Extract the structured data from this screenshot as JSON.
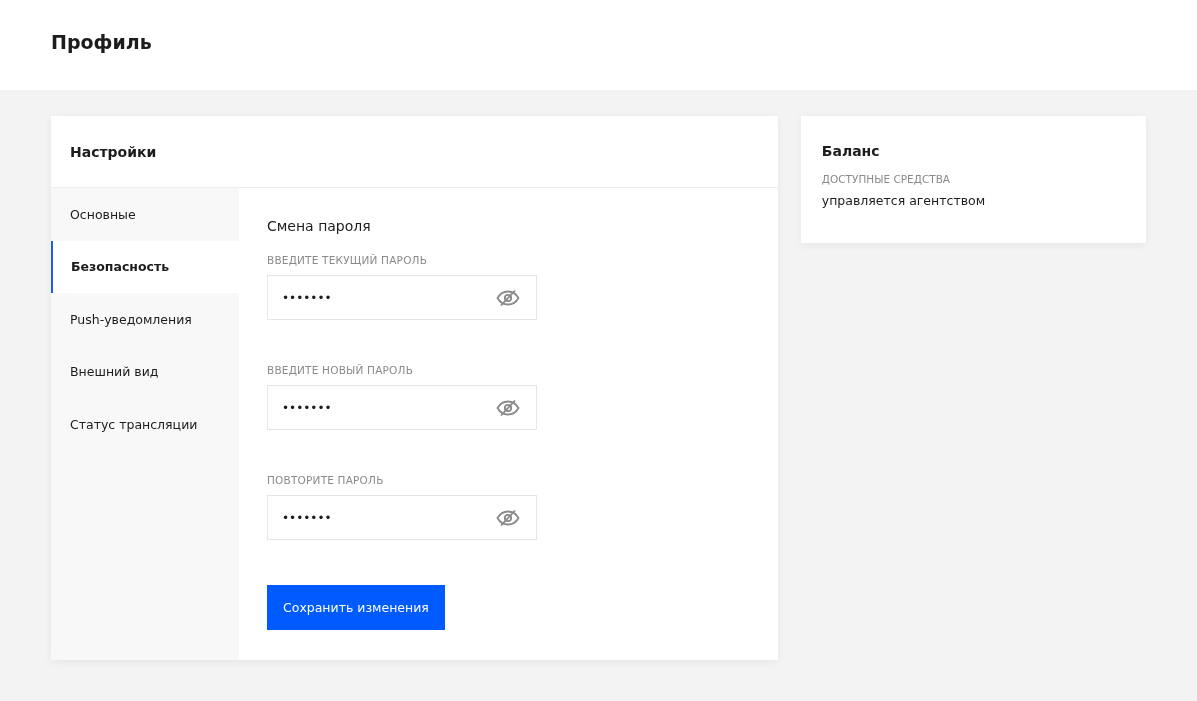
{
  "page": {
    "title": "Профиль"
  },
  "settings": {
    "title": "Настройки",
    "tabs": [
      {
        "label": "Основные",
        "selected": false
      },
      {
        "label": "Безопасность",
        "selected": true
      },
      {
        "label": "Push-уведомления",
        "selected": false
      },
      {
        "label": "Внешний вид",
        "selected": false
      },
      {
        "label": "Статус трансляции",
        "selected": false
      }
    ],
    "section_title": "Смена пароля",
    "fields": [
      {
        "label": "ВВЕДИТЕ ТЕКУЩИЙ ПАРОЛЬ",
        "value": "•••••••"
      },
      {
        "label": "ВВЕДИТЕ НОВЫЙ ПАРОЛЬ",
        "value": "•••••••"
      },
      {
        "label": "ПОВТОРИТЕ ПАРОЛЬ",
        "value": "•••••••"
      }
    ],
    "save_button": "Сохранить изменения"
  },
  "balance": {
    "title": "Баланс",
    "label": "ДОСТУПНЫЕ СРЕДСТВА",
    "value": "управляется агентством"
  }
}
